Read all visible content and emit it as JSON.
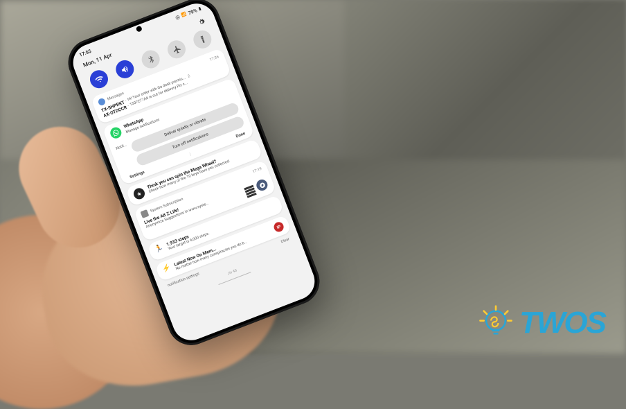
{
  "statusbar": {
    "time": "17:55",
    "battery": "79%",
    "signal_icons": [
      "nfc",
      "signal",
      "wifi",
      "battery"
    ]
  },
  "date": "Mon, 11 Apr",
  "quick_settings": [
    {
      "name": "wifi",
      "active": true
    },
    {
      "name": "sound",
      "active": true
    },
    {
      "name": "bluetooth",
      "active": false
    },
    {
      "name": "airplane",
      "active": false
    },
    {
      "name": "flashlight",
      "active": false
    }
  ],
  "notifications": {
    "messages": {
      "app": "Messages",
      "time": "17:36",
      "items": [
        {
          "sender": "TX-SHPRKT",
          "text": "Hi! Your order with Go deal! premiu...",
          "count": "2"
        },
        {
          "sender": "AX-OTDCCR",
          "text": "1507277A6 is out for delivery.Plz c..."
        }
      ]
    },
    "whatsapp": {
      "app": "WhatsApp",
      "manage": "Manage notifications",
      "notif_label": "Notif...",
      "options": [
        "Deliver quietly or vibrate",
        "Turn off notifications"
      ],
      "actions": {
        "settings": "Settings",
        "done": "Done"
      }
    },
    "promo": {
      "title": "Think you can spin the Mega Wheel?",
      "text": "Check how many of the 10 keys have you collected."
    },
    "subscription": {
      "app": "System Subscription",
      "time": "17:19",
      "title": "Live the Alt Z Life!",
      "text": "Anonymize Suggestions in www.syste..."
    },
    "health": {
      "title": "1,933 steps",
      "text": "Your target is 6,000 steps."
    },
    "news": {
      "title": "Latest Now On Mem...",
      "text": "No matter how many conspiracies you do b..."
    }
  },
  "bottom": {
    "settings": "notification settings",
    "clear": "Clear"
  },
  "footer": {
    "carrier": "Jio 4G"
  },
  "logo": {
    "text": "TWOS"
  },
  "colors": {
    "qs_active": "#2a3fd6",
    "qs_inactive": "#d8d8d8",
    "whatsapp": "#25d366",
    "logo": "#2aa5d6",
    "badge_red": "#c62828",
    "badge_blue": "#455a8a"
  }
}
